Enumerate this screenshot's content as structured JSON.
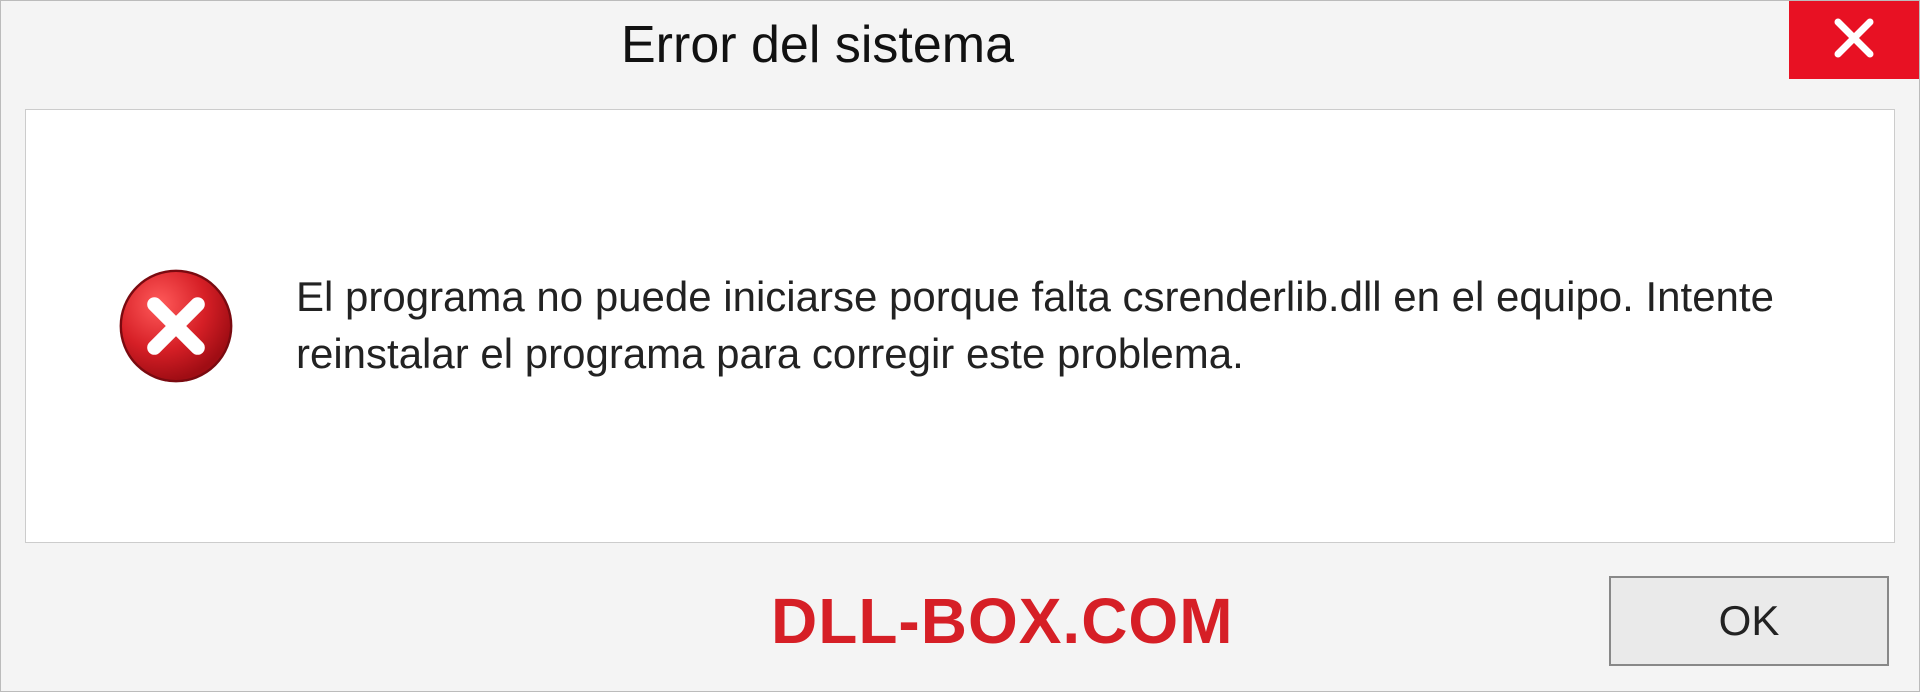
{
  "dialog": {
    "title": "Error del sistema",
    "message": "El programa no puede iniciarse porque falta csrenderlib.dll en el equipo. Intente reinstalar el programa para corregir este problema.",
    "ok_label": "OK"
  },
  "watermark": "DLL-BOX.COM",
  "icons": {
    "close": "close-icon",
    "error": "error-circle-x-icon"
  },
  "colors": {
    "close_bg": "#e81123",
    "watermark": "#d61f26",
    "dialog_bg": "#f4f4f4"
  }
}
